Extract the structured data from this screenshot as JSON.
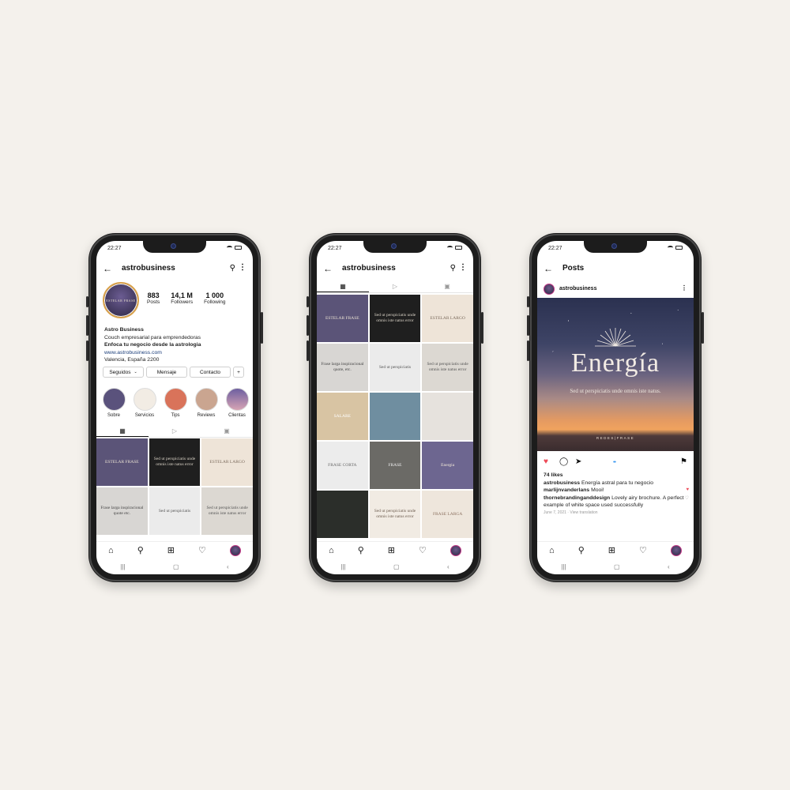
{
  "status": {
    "time": "22:27"
  },
  "profile": {
    "username": "astrobusiness",
    "avatar_text": "ESTELAR FRASE",
    "stats": [
      {
        "num": "883",
        "label": "Posts"
      },
      {
        "num": "14,1 M",
        "label": "Followers"
      },
      {
        "num": "1 000",
        "label": "Following"
      }
    ],
    "bio": {
      "name": "Astro Business",
      "line1": "Couch empresarial para emprendedoras",
      "line2": "Enfoca tu negocio desde la astrologia",
      "website": "www.astrobusiness.com",
      "location": "Valencia, España 2200"
    },
    "buttons": {
      "following": "Seguidos",
      "message": "Mensaje",
      "contact": "Contacto"
    },
    "highlights": [
      {
        "label": "Sobre",
        "color": "#5a527c"
      },
      {
        "label": "Servicios",
        "color": "#f2ece4"
      },
      {
        "label": "Tips",
        "color": "#d9735a"
      },
      {
        "label": "Reviews",
        "color": "#caa590"
      },
      {
        "label": "Clientas",
        "color": "#6d5fa0"
      }
    ],
    "grid": [
      {
        "text": "ESTELAR FRASE",
        "bg": "#5b5478",
        "fg": "#e9e1d3"
      },
      {
        "text": "Sed ut perspiciatis unde omnis iste natus error",
        "bg": "#1f1f1f",
        "fg": "#d9d2c6"
      },
      {
        "text": "ESTELAR LARGO",
        "bg": "#eee4d8",
        "fg": "#7a6a5c"
      },
      {
        "text": "Frase larga inspiracional quote etc.",
        "bg": "#d8d6d3",
        "fg": "#444"
      },
      {
        "text": "Sed ut perspiciatis",
        "bg": "#ebebeb",
        "fg": "#555"
      },
      {
        "text": "Sed ut perspiciatis unde omnis iste natus error",
        "bg": "#dcd8d2",
        "fg": "#555"
      }
    ]
  },
  "feed": {
    "username": "astrobusiness",
    "grid": [
      {
        "text": "ESTELAR FRASE",
        "bg": "#5b5478",
        "fg": "#e9e1d3"
      },
      {
        "text": "Sed ut perspiciatis unde omnis iste natus error",
        "bg": "#1f1f1f",
        "fg": "#d9d2c6"
      },
      {
        "text": "ESTELAR LARGO",
        "bg": "#eee4d8",
        "fg": "#7a6a5c"
      },
      {
        "text": "Frase larga inspiracional quote, etc.",
        "bg": "#d8d6d3",
        "fg": "#444"
      },
      {
        "text": "Sed ut perspiciatis",
        "bg": "#ebebeb",
        "fg": "#555"
      },
      {
        "text": "Sed ut perspiciatis unde omnis iste natus error",
        "bg": "#dcd8d2",
        "fg": "#555"
      },
      {
        "text": "SALARE",
        "bg": "#d8c4a3",
        "fg": "#fff"
      },
      {
        "text": "",
        "bg": "#6f8ea0",
        "fg": "#fff"
      },
      {
        "text": "",
        "bg": "#e6e2dd",
        "fg": "#555"
      },
      {
        "text": "FRASE CORTA",
        "bg": "#ececec",
        "fg": "#666"
      },
      {
        "text": "FRASE",
        "bg": "#6b6a66",
        "fg": "#f2f2f2"
      },
      {
        "text": "Energia",
        "bg": "#6d6690",
        "fg": "#f3ead9"
      },
      {
        "text": "",
        "bg": "#2b2e2a",
        "fg": "#ddd"
      },
      {
        "text": "Sed ut perspiciatis unde omnis iste natus error",
        "bg": "#f1ebe3",
        "fg": "#6d5d4f"
      },
      {
        "text": "FRASE LARGA",
        "bg": "#eee6dc",
        "fg": "#8a6f5e"
      }
    ]
  },
  "post": {
    "header_title": "Posts",
    "username": "astrobusiness",
    "image_title": "Energía",
    "image_subtitle": "Sed ut perspiciatis unde omnis iste natus.",
    "image_brand": "REDES|FRASE",
    "likes": "74 likes",
    "caption_user": "astrobusiness",
    "caption_text": "Energía astral para tu negocio",
    "comment1_user": "marlijnvanderlans",
    "comment1_text": "Mooi!",
    "comment2_user": "thornebrandinganddesign",
    "comment2_text": "Lovely airy brochure. A perfect example of white space used successfully",
    "date": "June 7, 2021",
    "translation": "View translation"
  }
}
